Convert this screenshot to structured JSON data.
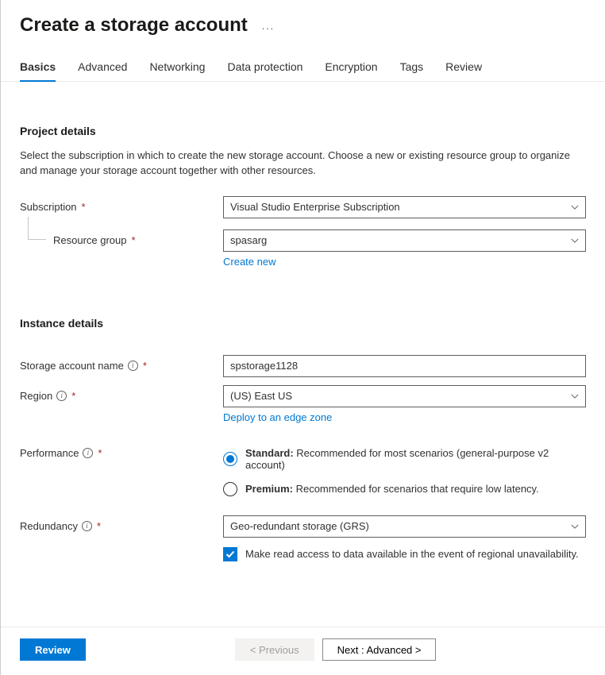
{
  "header": {
    "title": "Create a storage account"
  },
  "tabs": [
    "Basics",
    "Advanced",
    "Networking",
    "Data protection",
    "Encryption",
    "Tags",
    "Review"
  ],
  "sections": {
    "project": {
      "title": "Project details",
      "desc": "Select the subscription in which to create the new storage account. Choose a new or existing resource group to organize and manage your storage account together with other resources.",
      "subscription": {
        "label": "Subscription",
        "value": "Visual Studio Enterprise Subscription"
      },
      "resource_group": {
        "label": "Resource group",
        "value": "spasarg",
        "create_new": "Create new"
      }
    },
    "instance": {
      "title": "Instance details",
      "storage_name": {
        "label": "Storage account name",
        "value": "spstorage1128"
      },
      "region": {
        "label": "Region",
        "value": "(US) East US",
        "edge_link": "Deploy to an edge zone"
      },
      "performance": {
        "label": "Performance",
        "options": {
          "standard_b": "Standard:",
          "standard_t": " Recommended for most scenarios (general-purpose v2 account)",
          "premium_b": "Premium:",
          "premium_t": " Recommended for scenarios that require low latency."
        }
      },
      "redundancy": {
        "label": "Redundancy",
        "value": "Geo-redundant storage (GRS)",
        "checkbox": "Make read access to data available in the event of regional unavailability."
      }
    }
  },
  "footer": {
    "review": "Review",
    "previous": "< Previous",
    "next": "Next : Advanced >"
  }
}
